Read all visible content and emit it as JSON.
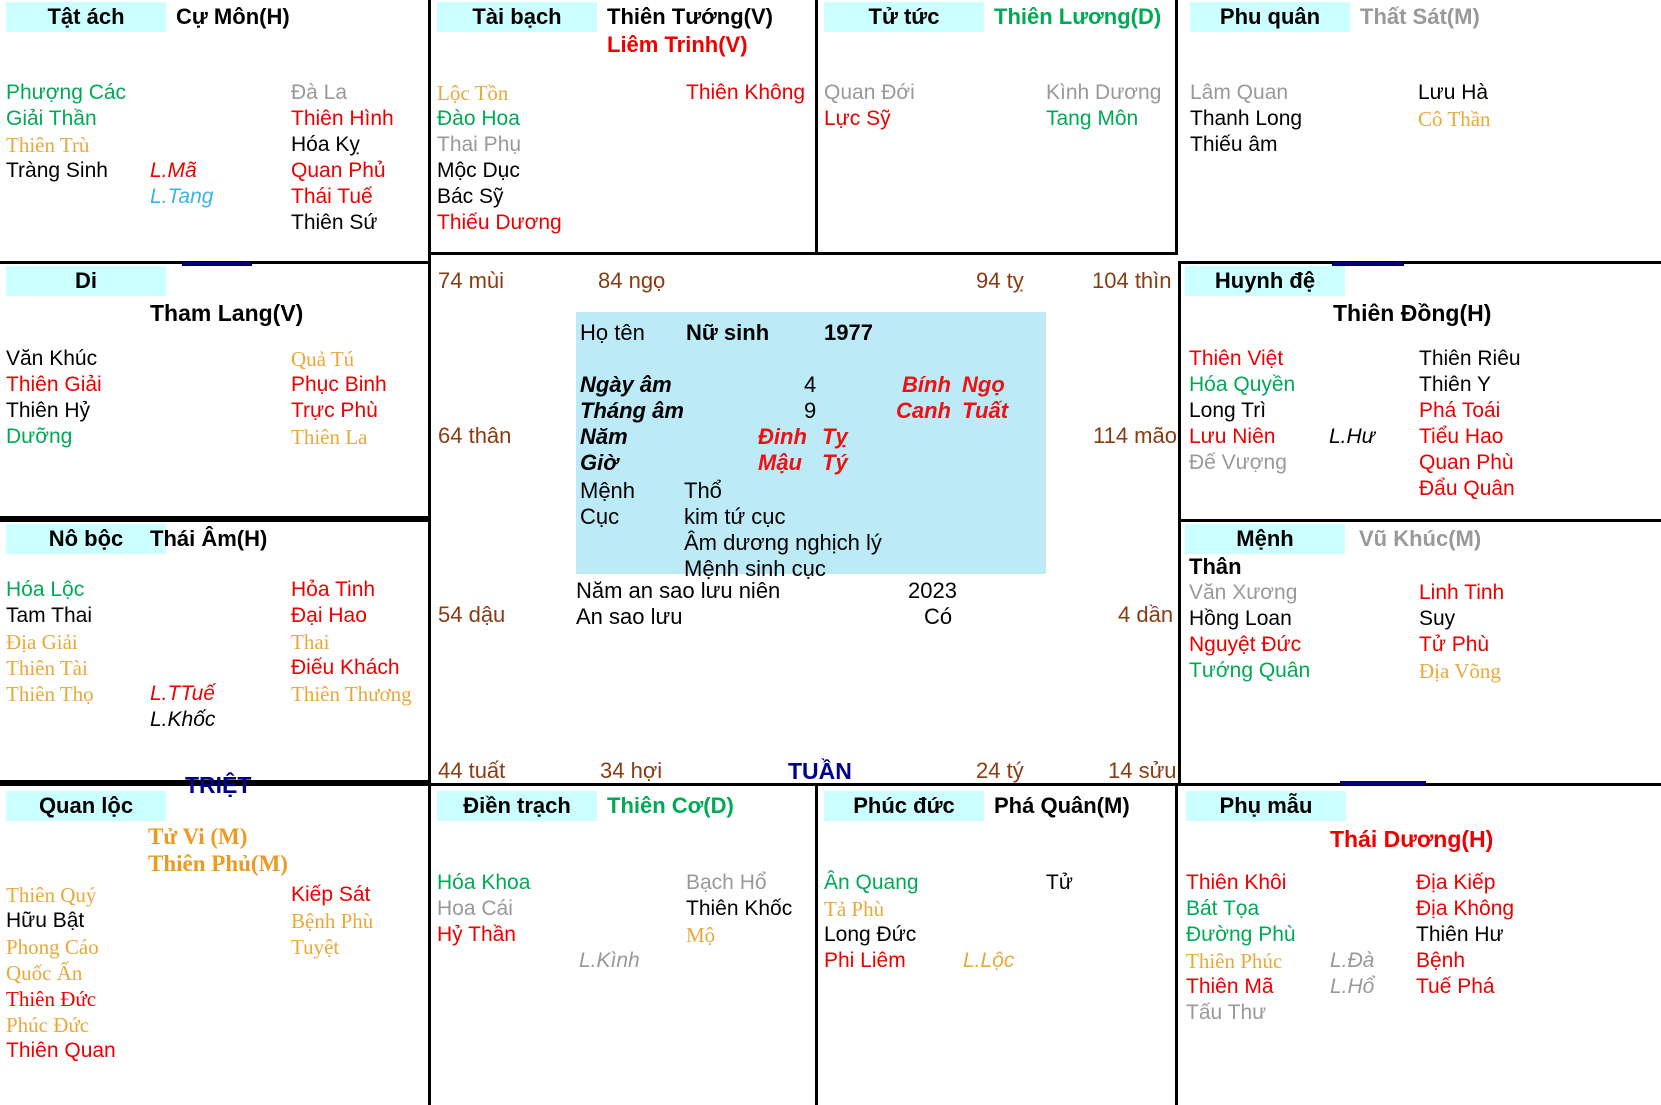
{
  "meta": {
    "chart_type": "Vietnamese Tu Vi (Zi Wei Dou Shu) astrology chart",
    "markers": {
      "triet": "TRIỆT",
      "tuan": "TUẦN"
    }
  },
  "center": {
    "label_name": "Họ tên",
    "gender": "Nữ sinh",
    "year": "1977",
    "rows": [
      {
        "label": "Ngày âm",
        "value": "4",
        "can": "Bính",
        "chi": "Ngọ"
      },
      {
        "label": "Tháng âm",
        "value": "9",
        "can": "Canh",
        "chi": "Tuất"
      },
      {
        "label": "Năm",
        "value": "",
        "can": "Đinh",
        "chi": "Tỵ"
      },
      {
        "label": "Giờ",
        "value": "",
        "can": "Mậu",
        "chi": "Tý"
      }
    ],
    "menh_label": "Mệnh",
    "menh_value": "Thổ",
    "cuc_label": "Cục",
    "cuc_value": "kim tứ cục",
    "cuc_note1": "Âm dương nghịch lý",
    "cuc_note2": "Mệnh sinh cục",
    "luu_nien_label": "Năm an sao lưu niên",
    "luu_nien_value": "2023",
    "an_sao_label": "An sao lưu",
    "an_sao_value": "Có"
  },
  "ages": [
    {
      "text": "74 mùi"
    },
    {
      "text": "84 ngọ"
    },
    {
      "text": "94 tỵ"
    },
    {
      "text": "104 thìn"
    },
    {
      "text": "64 thân"
    },
    {
      "text": "114 mão"
    },
    {
      "text": "54 dậu"
    },
    {
      "text": "4 dần"
    },
    {
      "text": "44 tuất"
    },
    {
      "text": "34 hợi"
    },
    {
      "text": "24 tý"
    },
    {
      "text": "14 sửu"
    }
  ],
  "palaces": [
    {
      "id": "tat-ach",
      "name": "Tật ách",
      "main_stars": [
        {
          "text": "Cự Môn(H)",
          "color": "black"
        }
      ],
      "left": [
        {
          "text": "Phượng Các",
          "color": "green"
        },
        {
          "text": "Giải Thần",
          "color": "green"
        },
        {
          "text": "Thiên Trù",
          "color": "gold",
          "serif": true
        },
        {
          "text": "Tràng Sinh",
          "color": "black"
        }
      ],
      "mid": [
        {
          "text": "L.Mã",
          "color": "red"
        },
        {
          "text": "L.Tang",
          "color": "blue"
        }
      ],
      "right": [
        {
          "text": "Đà La",
          "color": "grey"
        },
        {
          "text": "Thiên Hình",
          "color": "red"
        },
        {
          "text": "Hóa Kỵ",
          "color": "black"
        },
        {
          "text": "Quan Phủ",
          "color": "red"
        },
        {
          "text": "Thái Tuế",
          "color": "red"
        },
        {
          "text": "Thiên Sứ",
          "color": "black"
        }
      ]
    },
    {
      "id": "tai-bach",
      "name": "Tài bạch",
      "main_stars": [
        {
          "text": "Thiên Tướng(V)",
          "color": "black"
        },
        {
          "text": "Liêm Trinh(V)",
          "color": "red"
        }
      ],
      "left": [
        {
          "text": "Lộc Tồn",
          "color": "gold",
          "serif": true
        },
        {
          "text": "Đào Hoa",
          "color": "green"
        },
        {
          "text": "Thai Phụ",
          "color": "grey"
        },
        {
          "text": "Mộc Dục",
          "color": "black"
        },
        {
          "text": "Bác Sỹ",
          "color": "black"
        },
        {
          "text": "Thiếu Dương",
          "color": "red"
        }
      ],
      "mid": [],
      "right": [
        {
          "text": "Thiên Không",
          "color": "red"
        }
      ]
    },
    {
      "id": "tu-tuc",
      "name": "Tử tức",
      "main_stars": [
        {
          "text": "Thiên Lương(D)",
          "color": "green"
        }
      ],
      "left": [
        {
          "text": "Quan Đới",
          "color": "grey"
        },
        {
          "text": "Lực Sỹ",
          "color": "red"
        }
      ],
      "mid": [],
      "right": [
        {
          "text": "Kình Dương",
          "color": "grey"
        },
        {
          "text": "Tang Môn",
          "color": "green"
        }
      ]
    },
    {
      "id": "phu-quan",
      "name": "Phu quân",
      "main_stars": [
        {
          "text": "Thất Sát(M)",
          "color": "grey"
        }
      ],
      "left": [
        {
          "text": "Lâm Quan",
          "color": "grey"
        },
        {
          "text": "Thanh Long",
          "color": "black"
        },
        {
          "text": "Thiếu âm",
          "color": "black"
        }
      ],
      "mid": [],
      "right": [
        {
          "text": "Lưu Hà",
          "color": "black"
        },
        {
          "text": "Cô Thần",
          "color": "gold",
          "serif": true
        }
      ]
    },
    {
      "id": "di",
      "name": "Di",
      "main_stars": [
        {
          "text": "Tham Lang(V)",
          "color": "black"
        }
      ],
      "left": [
        {
          "text": "Văn Khúc",
          "color": "black"
        },
        {
          "text": "Thiên Giải",
          "color": "red"
        },
        {
          "text": "Thiên Hỷ",
          "color": "black"
        },
        {
          "text": "Dưỡng",
          "color": "green"
        }
      ],
      "mid": [],
      "right": [
        {
          "text": "Quả Tú",
          "color": "gold",
          "serif": true
        },
        {
          "text": "Phục Binh",
          "color": "red"
        },
        {
          "text": "Trực Phù",
          "color": "red"
        },
        {
          "text": "Thiên La",
          "color": "gold",
          "serif": true
        }
      ]
    },
    {
      "id": "huynh-de",
      "name": "Huynh đệ",
      "main_stars": [
        {
          "text": "Thiên Đồng(H)",
          "color": "black"
        }
      ],
      "left": [
        {
          "text": "Thiên Việt",
          "color": "red"
        },
        {
          "text": "Hóa Quyền",
          "color": "green"
        },
        {
          "text": "Long Trì",
          "color": "black"
        },
        {
          "text": "Lưu Niên",
          "color": "red"
        },
        {
          "text": "Đế Vượng",
          "color": "grey"
        }
      ],
      "mid": [
        {
          "text": "L.Hư",
          "color": "black"
        }
      ],
      "right": [
        {
          "text": "Thiên Riêu",
          "color": "black"
        },
        {
          "text": "Thiên Y",
          "color": "black"
        },
        {
          "text": "Phá Toái",
          "color": "red"
        },
        {
          "text": "Tiểu Hao",
          "color": "red"
        },
        {
          "text": "Quan Phù",
          "color": "red"
        },
        {
          "text": "Đẩu Quân",
          "color": "red"
        }
      ]
    },
    {
      "id": "no-boc",
      "name": "Nô bộc",
      "main_stars": [
        {
          "text": "Thái Âm(H)",
          "color": "black"
        }
      ],
      "left": [
        {
          "text": "Hóa Lộc",
          "color": "green"
        },
        {
          "text": "Tam Thai",
          "color": "black"
        },
        {
          "text": "Địa Giải",
          "color": "gold",
          "serif": true
        },
        {
          "text": "Thiên Tài",
          "color": "gold",
          "serif": true
        },
        {
          "text": "Thiên Thọ",
          "color": "gold",
          "serif": true
        }
      ],
      "mid": [
        {
          "text": "L.TTuế",
          "color": "red"
        },
        {
          "text": "L.Khốc",
          "color": "black"
        }
      ],
      "right": [
        {
          "text": "Hỏa Tinh",
          "color": "red"
        },
        {
          "text": "Đại Hao",
          "color": "red"
        },
        {
          "text": "Thai",
          "color": "gold",
          "serif": true
        },
        {
          "text": "Điếu Khách",
          "color": "red"
        },
        {
          "text": "Thiên Thương",
          "color": "gold",
          "serif": true
        }
      ]
    },
    {
      "id": "menh",
      "name": "Mệnh",
      "than_label": "Thân",
      "main_stars": [
        {
          "text": "Vũ Khúc(M)",
          "color": "grey"
        }
      ],
      "left": [
        {
          "text": "Văn Xương",
          "color": "grey"
        },
        {
          "text": "Hồng Loan",
          "color": "black"
        },
        {
          "text": "Nguyệt Đức",
          "color": "red"
        },
        {
          "text": "Tướng Quân",
          "color": "green"
        }
      ],
      "mid": [],
      "right": [
        {
          "text": "Linh Tinh",
          "color": "red"
        },
        {
          "text": "Suy",
          "color": "black"
        },
        {
          "text": "Tử Phù",
          "color": "red"
        },
        {
          "text": "Địa Võng",
          "color": "gold",
          "serif": true
        }
      ]
    },
    {
      "id": "quan-loc",
      "name": "Quan lộc",
      "main_stars": [
        {
          "text": "Tử Vi (M)",
          "color": "orange",
          "serif": true
        },
        {
          "text": "Thiên Phủ(M)",
          "color": "orange",
          "serif": true
        }
      ],
      "left": [
        {
          "text": "Thiên Quý",
          "color": "gold",
          "serif": true
        },
        {
          "text": "Hữu Bật",
          "color": "black"
        },
        {
          "text": "Phong Cáo",
          "color": "gold",
          "serif": true
        },
        {
          "text": "Quốc Ấn",
          "color": "gold",
          "serif": true
        },
        {
          "text": "Thiên Đức",
          "color": "red",
          "serif": true
        },
        {
          "text": "Phúc Đức",
          "color": "gold",
          "serif": true
        },
        {
          "text": "Thiên Quan",
          "color": "red"
        }
      ],
      "mid": [],
      "right": [
        {
          "text": "Kiếp Sát",
          "color": "red"
        },
        {
          "text": "Bệnh Phù",
          "color": "gold",
          "serif": true
        },
        {
          "text": "Tuyệt",
          "color": "gold",
          "serif": true
        }
      ]
    },
    {
      "id": "dien-trach",
      "name": "Điền trạch",
      "main_stars": [
        {
          "text": "Thiên Cơ(D)",
          "color": "green"
        }
      ],
      "left": [
        {
          "text": "Hóa Khoa",
          "color": "green"
        },
        {
          "text": "Hoa Cái",
          "color": "grey"
        },
        {
          "text": "Hỷ Thần",
          "color": "red"
        }
      ],
      "mid": [
        {
          "text": "L.Kình",
          "color": "grey"
        }
      ],
      "right": [
        {
          "text": "Bạch Hổ",
          "color": "grey"
        },
        {
          "text": "Thiên Khốc",
          "color": "black"
        },
        {
          "text": "Mộ",
          "color": "gold",
          "serif": true
        }
      ]
    },
    {
      "id": "phuc-duc",
      "name": "Phúc đức",
      "main_stars": [
        {
          "text": "Phá Quân(M)",
          "color": "black"
        }
      ],
      "left": [
        {
          "text": "Ân Quang",
          "color": "green"
        },
        {
          "text": "Tả Phù",
          "color": "gold",
          "serif": true
        },
        {
          "text": "Long Đức",
          "color": "black"
        },
        {
          "text": "Phi Liêm",
          "color": "red"
        }
      ],
      "mid": [
        {
          "text": "L.Lộc",
          "color": "gold"
        }
      ],
      "right": [
        {
          "text": "Tử",
          "color": "black"
        }
      ]
    },
    {
      "id": "phu-mau",
      "name": "Phụ mẫu",
      "main_stars": [
        {
          "text": "Thái Dương(H)",
          "color": "red"
        }
      ],
      "left": [
        {
          "text": "Thiên Khôi",
          "color": "red"
        },
        {
          "text": "Bát Tọa",
          "color": "green"
        },
        {
          "text": "Đường Phù",
          "color": "green"
        },
        {
          "text": "Thiên Phúc",
          "color": "gold",
          "serif": true
        },
        {
          "text": "Thiên Mã",
          "color": "red"
        },
        {
          "text": "Tấu Thư",
          "color": "grey"
        }
      ],
      "mid": [
        {
          "text": "L.Đà",
          "color": "grey"
        },
        {
          "text": "L.Hổ",
          "color": "grey"
        }
      ],
      "right": [
        {
          "text": "Địa Kiếp",
          "color": "red"
        },
        {
          "text": "Địa Không",
          "color": "red"
        },
        {
          "text": "Thiên Hư",
          "color": "black"
        },
        {
          "text": "Bệnh",
          "color": "red"
        },
        {
          "text": "Tuế Phá",
          "color": "red"
        }
      ]
    }
  ],
  "colors": {
    "cyan_header": "#ccffff",
    "center_bg": "#bdeaf7",
    "age_text": "#8a3b12",
    "marker_blue": "#00008b",
    "red": "#ee0000",
    "green": "#00aa55",
    "gold": "#e8a93a",
    "grey": "#999999"
  }
}
